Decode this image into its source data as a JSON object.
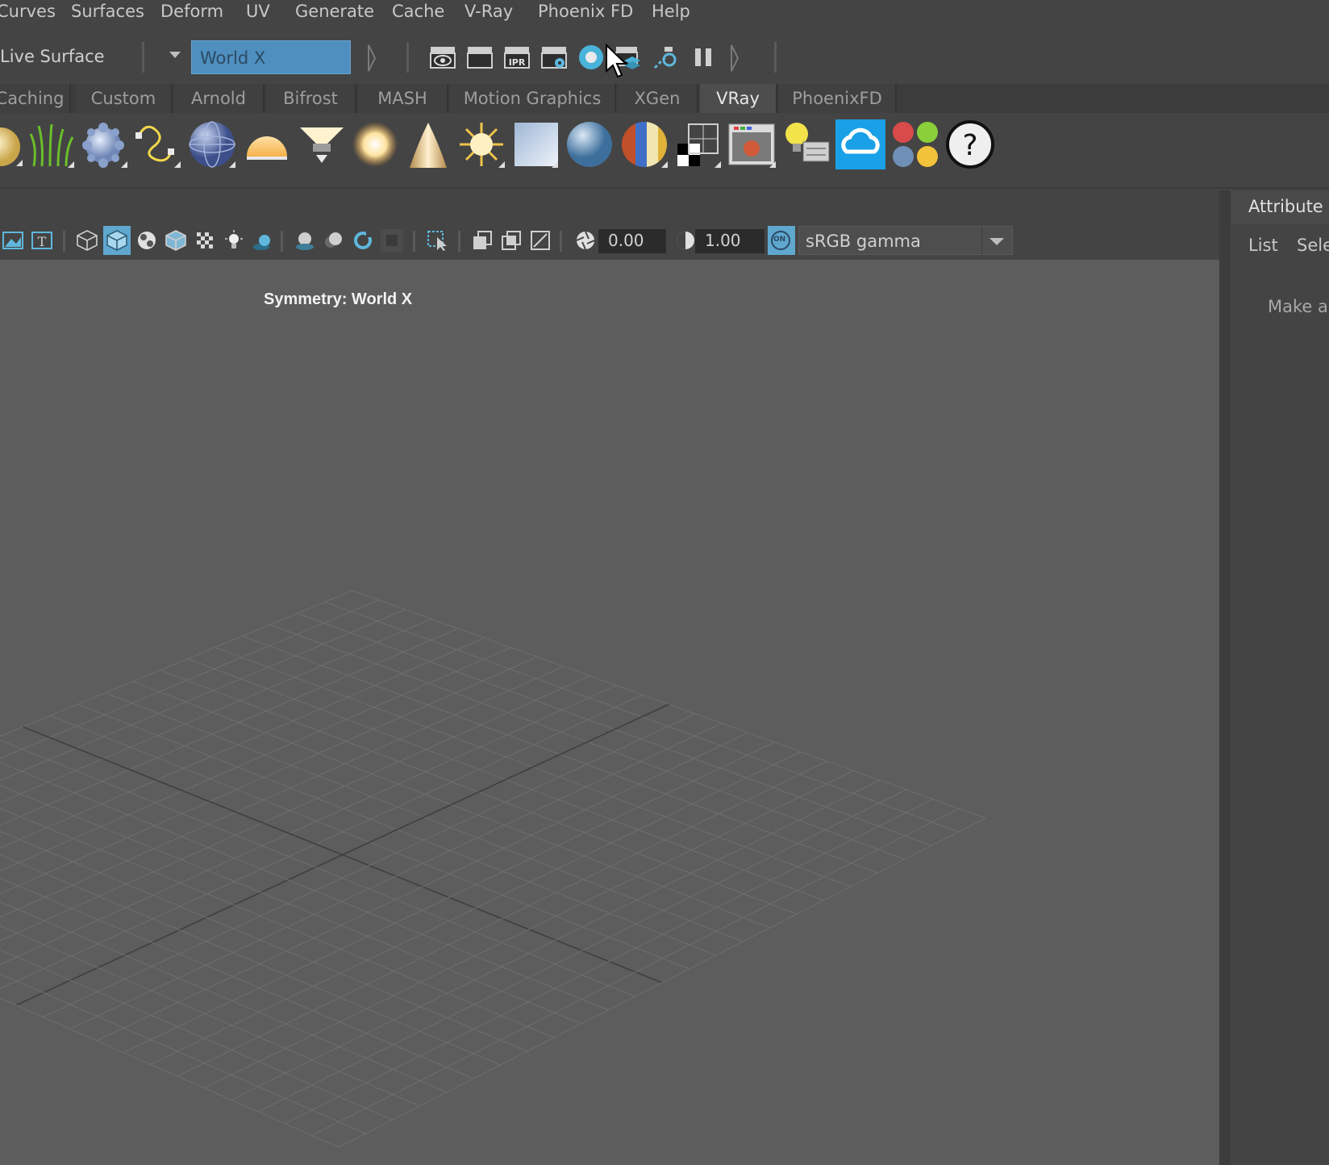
{
  "menubar": {
    "items": [
      "Curves",
      "Surfaces",
      "Deform",
      "UV",
      "Generate",
      "Cache",
      "V-Ray",
      "Phoenix FD",
      "Help"
    ]
  },
  "statusline": {
    "live_surface_label": "Live Surface",
    "symmetry_value": "World X",
    "icons": [
      "render-view-icon",
      "render-current-frame-icon",
      "ipr-render-icon",
      "render-settings-icon",
      "vray-render-icon",
      "vray-render-layers-icon",
      "vray-interactive-icon",
      "pause-icon"
    ]
  },
  "shelf": {
    "tabs": [
      "Caching",
      "Custom",
      "Arnold",
      "Bifrost",
      "MASH",
      "Motion Graphics",
      "XGen",
      "VRay",
      "PhoenixFD"
    ],
    "active_tab": "VRay",
    "icons": [
      "vray-sphere-light-icon",
      "vray-fur-icon",
      "vray-proxy-icon",
      "vray-rect-curve-icon",
      "vray-dome-sphere-icon",
      "vray-dome-light-icon",
      "vray-spot-light-icon",
      "vray-ies-light-icon",
      "vray-cone-light-icon",
      "vray-sun-icon",
      "vray-plane-icon",
      "vray-material-sphere-icon",
      "vray-multi-material-icon",
      "vray-checker-icon",
      "vray-frame-buffer-icon",
      "vray-light-lister-icon",
      "vray-cloud-icon",
      "vray-material-library-icon",
      "help-icon"
    ]
  },
  "viewport_toolbar": {
    "exposure": "0.00",
    "gamma": "1.00",
    "color_management_on": "ON",
    "color_space": "sRGB gamma"
  },
  "viewport": {
    "symmetry_label": "Symmetry: World X"
  },
  "attribute_editor": {
    "tab_title": "Attribute E",
    "menu_list": "List",
    "menu_select": "Sele",
    "hint": "Make a"
  },
  "colors": {
    "background": "#444444",
    "viewport": "#5d5d5d",
    "accent": "#4e8fbf",
    "shelf_active": "#4d4d4d"
  }
}
